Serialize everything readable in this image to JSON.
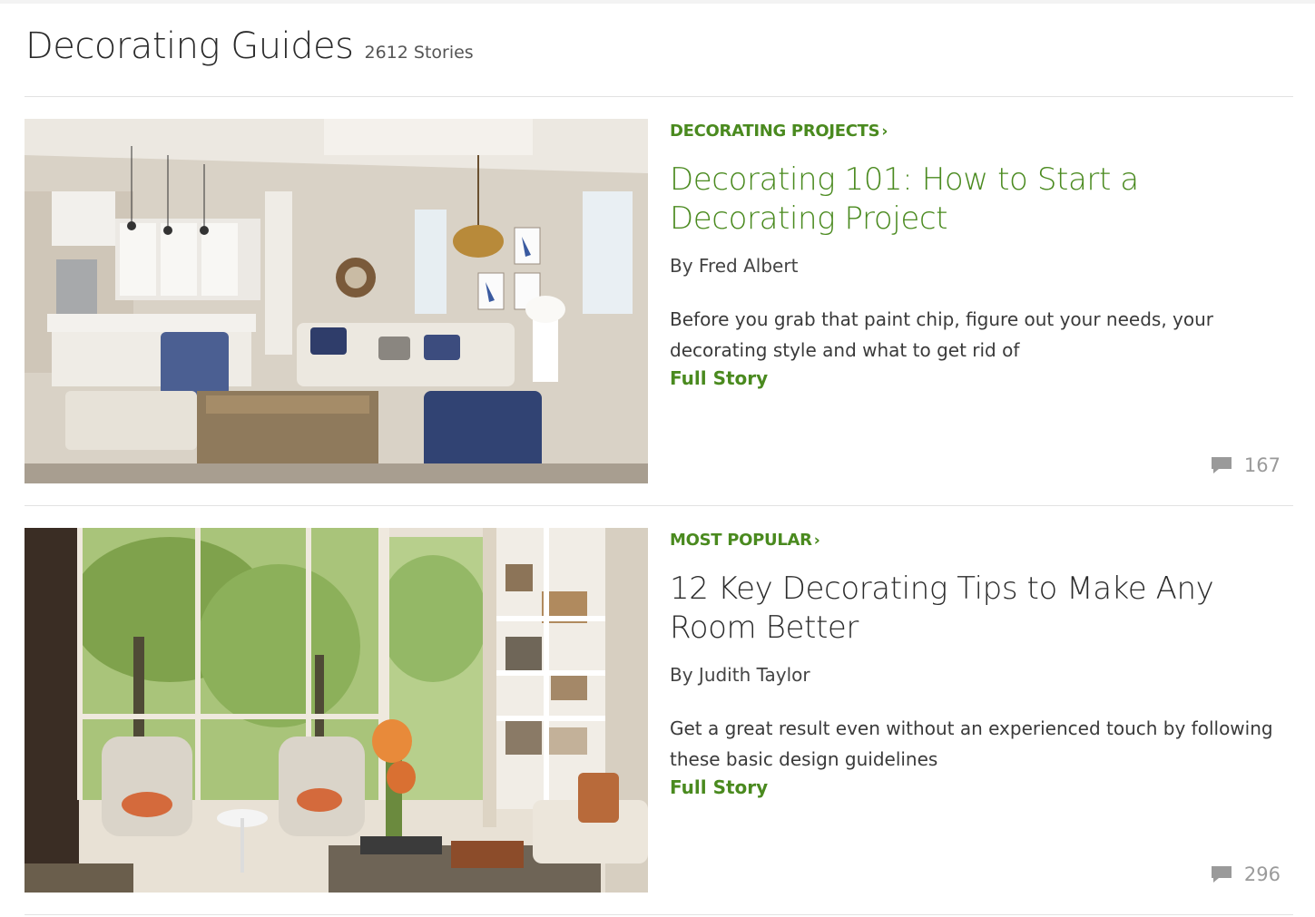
{
  "header": {
    "title": "Decorating Guides",
    "story_count": "2612 Stories"
  },
  "articles": [
    {
      "category": "DECORATING PROJECTS",
      "title": "Decorating 101: How to Start a Decorating Project",
      "author": "By Fred Albert",
      "summary": "Before you grab that paint chip, figure out your needs, your decorating style and what to get rid of",
      "full_story_label": "Full Story",
      "comment_count": "167",
      "image": "living room with kitchen, chandelier and sofa",
      "title_color": "#4a8a1f"
    },
    {
      "category": "MOST POPULAR",
      "title": "12 Key Decorating Tips to Make Any Room Better",
      "author": "By Judith Taylor",
      "summary": "Get a great result even without an experienced touch by following these basic design guidelines",
      "full_story_label": "Full Story",
      "comment_count": "296",
      "image": "sunroom with armchairs, large windows and bookshelves",
      "title_color": "#2b2b2b"
    }
  ],
  "colors": {
    "accent_green": "#4a8a1f",
    "text_dark": "#2b2b2b",
    "muted_gray": "#9a9a9a",
    "divider": "#e2e2e2"
  },
  "icons": {
    "chevron": "chevron-right-icon",
    "comment": "comment-bubble-icon"
  }
}
